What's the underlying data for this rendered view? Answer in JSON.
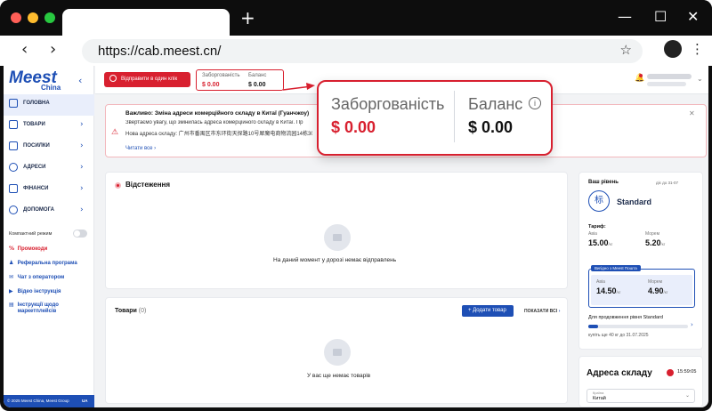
{
  "browser": {
    "url": "https://cab.meest.cn/",
    "new_tab": "+",
    "win_min": "—",
    "win_max": "☐",
    "win_close": "✕",
    "back": "‹",
    "forward": "›",
    "star": "☆",
    "menu": "⋮",
    "dot_colors": [
      "#ff5f57",
      "#febc2e",
      "#28c840"
    ]
  },
  "logo": {
    "brand": "Meest",
    "sub": "China"
  },
  "sidebar": {
    "items": [
      {
        "label": "ГОЛОВНА",
        "icon": "dashboard-icon"
      },
      {
        "label": "ТОВАРИ",
        "icon": "box-icon"
      },
      {
        "label": "ПОСИЛКИ",
        "icon": "package-icon"
      },
      {
        "label": "АДРЕСИ",
        "icon": "location-icon"
      },
      {
        "label": "ФІНАНСИ",
        "icon": "wallet-icon"
      },
      {
        "label": "ДОПОМОГА",
        "icon": "help-icon"
      }
    ],
    "compact_mode": "Компактний режим",
    "links": [
      {
        "label": "Промокоди",
        "icon": "%"
      },
      {
        "label": "Реферальна програма",
        "icon": "♟"
      },
      {
        "label": "Чат з оператором",
        "icon": "✉"
      },
      {
        "label": "Відео інструкція",
        "icon": "▶"
      },
      {
        "label": "Інструкції щодо",
        "icon": "▤"
      },
      {
        "label": "маркетплейсів",
        "icon": ""
      }
    ],
    "footer_left": "© 2025 Meest China, Meest Group",
    "footer_right": "UA"
  },
  "header": {
    "send_button": "Відправити в один клік",
    "debt_label": "Заборгованість",
    "debt_value": "$ 0.00",
    "balance_label": "Баланс",
    "balance_value": "$ 0.00"
  },
  "notice": {
    "title": "Важливо: Зміна адреси комерційного складу в Китаї (Гуанчжоу)",
    "line1": "Звертаємо увагу, що змінилась адреса комерційного складу в Китаї. Пр",
    "line2": "Нова адреса складу: 广州市番禺区市东环街天探路10号犀魔电商物流园14栋301 M",
    "more": "Читати все",
    "more_chev": "›"
  },
  "tracking": {
    "title": "Відстеження",
    "empty": "На даний момент у дорозі немає відправлень"
  },
  "goods": {
    "title": "Товари",
    "count": "(0)",
    "add_button": "+ Додати товар",
    "show_all": "ПОКАЗАТИ ВСІ",
    "empty": "У вас ще немає товарів"
  },
  "level": {
    "your_level": "Ваш рівень",
    "valid": "діє до 31-07",
    "badge": "标",
    "name": "Standard",
    "tariff": "Тариф:",
    "avia_label": "Авіа",
    "avia_value": "15.00",
    "sea_label": "Морем",
    "sea_value": "5.20",
    "unit": "/кг",
    "benefit_tag": "Вигідно з Meest Пошта",
    "b_avia_label": "Авіа",
    "b_avia_value": "14.50",
    "b_sea_label": "Морем",
    "b_sea_value": "4.90",
    "prolong": "Для продовження рівня Standard",
    "buy_more": "купіть ще 40 кг до 31.07.2025",
    "progress": 0.1
  },
  "warehouse": {
    "title": "Адреса складу",
    "time": "15:59:05",
    "country_label": "Країна",
    "country_value": "Китай"
  },
  "callout": {
    "debt_label": "Заборгованість",
    "debt_value": "$ 0.00",
    "balance_label": "Баланс",
    "balance_value": "$ 0.00",
    "info": "i"
  },
  "colors": {
    "accent": "#1e4fb5",
    "brand_red": "#d8202f"
  }
}
